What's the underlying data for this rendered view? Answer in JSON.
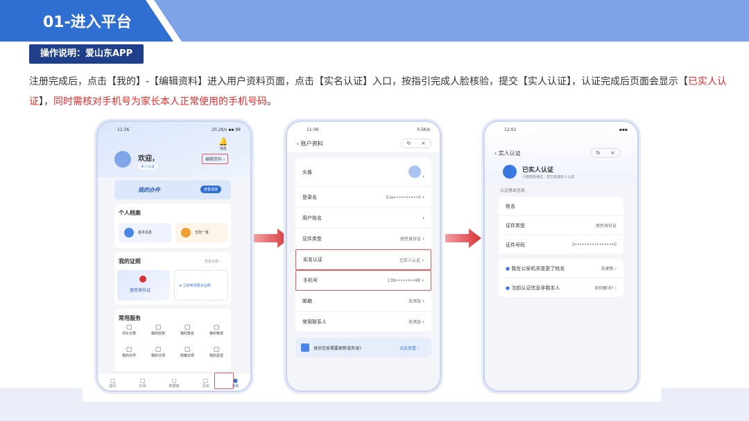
{
  "header": {
    "title": "01-进入平台",
    "op_label": "操作说明：爱山东APP"
  },
  "description": {
    "part1": "注册完成后，点击【我的】-【编辑资料】进入用户资料页面，点击【实名认证】入口，按指引完成人脸核验，提交【实人认证】，认证完成后页面会显示【",
    "highlight1": "已实人认证",
    "part2": "】，",
    "highlight2": "同时需核对手机号为家长本人正常使用的手机号码",
    "part3": "。"
  },
  "phone1": {
    "time": "11:36",
    "signal": "20.2K/s",
    "battery": "88",
    "bell_label": "消息",
    "welcome": "欢迎，",
    "badge": "实人认证",
    "edit_profile": "编辑资料",
    "my_tasks": "我的办件",
    "view_progress": "查看进度",
    "personal_archive": "个人档案",
    "basic_info": "基本信息",
    "five_in_one": "五险一金",
    "my_licenses": "我的证照",
    "view_all": "查看全部",
    "id_card": "居民身份证",
    "apply_more": "立即申领更多证照",
    "common_services": "常用服务",
    "services": [
      "评价记录",
      "我的授权",
      "我的签名",
      "我的物流",
      "我的办件",
      "我的订阅",
      "政策兑现",
      "我的足迹"
    ],
    "tabs": [
      "首页",
      "办事",
      "数据链",
      "互动",
      "我的"
    ]
  },
  "phone2": {
    "time": "11:36",
    "signal": "0.5K/s",
    "title": "账户资料",
    "rows": [
      {
        "label": "头像",
        "value": ""
      },
      {
        "label": "登录名",
        "value": "Exe••••••••••0"
      },
      {
        "label": "用户姓名",
        "value": ""
      },
      {
        "label": "证件类型",
        "value": "居民身份证"
      },
      {
        "label": "实名认证",
        "value": "已实人认证"
      },
      {
        "label": "手机号",
        "value": "138••••••••88"
      },
      {
        "label": "邮箱",
        "value": "去添加"
      },
      {
        "label": "常用联系人",
        "value": "去添加"
      }
    ],
    "banner": "身份信息需要更新或有误?",
    "banner_link": "点此查看"
  },
  "phone3": {
    "time": "12:02",
    "title": "实人认证",
    "status_title": "已实人认证",
    "status_sub": "人脸核验通过，您已完成实人认证",
    "section": "认证基本信息",
    "rows": [
      {
        "label": "姓名",
        "value": ""
      },
      {
        "label": "证件类型",
        "value": "居民身份证"
      },
      {
        "label": "证件号码",
        "value": "3••••••••••••••••0"
      }
    ],
    "notices": [
      {
        "text": "我在公安机关变更了姓名",
        "link": "去更新"
      },
      {
        "text": "当前认证信息非我本人",
        "link": "如何解决?"
      }
    ]
  },
  "colors": {
    "primary": "#2f6fd2",
    "band": "#7da2e6",
    "highlight": "#e52b2b",
    "arrow": "#d9323a"
  }
}
